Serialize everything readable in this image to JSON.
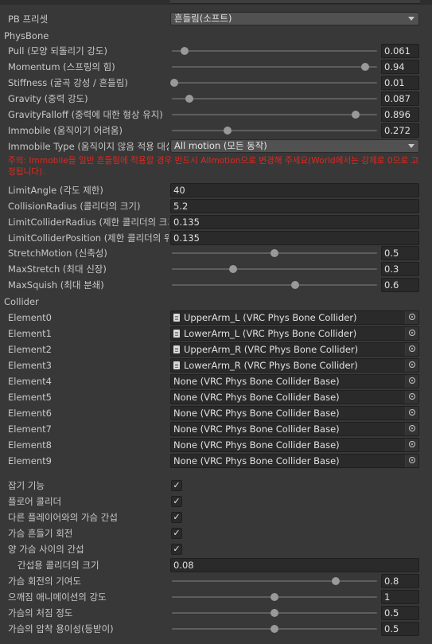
{
  "preset": {
    "label": "PB 프리셋",
    "value": "흔들림(소프트)"
  },
  "physbone_header": "PhysBone",
  "sliders_a": [
    {
      "label": "Pull (모양 되돌리기 강도)",
      "value": "0.061",
      "fraction": 0.061
    },
    {
      "label": "Momentum (스프링의 힘)",
      "value": "0.94",
      "fraction": 0.94
    },
    {
      "label": "Stiffness (굴곡 강성 / 흔들림)",
      "value": "0.01",
      "fraction": 0.01
    },
    {
      "label": "Gravity (중력 강도)",
      "value": "0.087",
      "fraction": 0.087
    },
    {
      "label": "GravityFalloff (중력에 대한 형상 유지)",
      "value": "0.896",
      "fraction": 0.896
    },
    {
      "label": "Immobile (움직이기 어려움)",
      "value": "0.272",
      "fraction": 0.272
    }
  ],
  "immobile_type": {
    "label": "Immobile Type (움직이지 않음 적용 대상)",
    "value": "All motion (모든 동작)"
  },
  "warning": "주의: Immobile을 일반 흔들림에 적용할 경우 반드시 Allmotion으로 변경해 주세요(World에서는 강제로 0으로 고정됩니다).",
  "limits": [
    {
      "label": "LimitAngle (각도 제한)",
      "value": "40"
    },
    {
      "label": "CollisionRadius (콜리더의 크기)",
      "value": "5.2"
    },
    {
      "label": "LimitColliderRadius (제한 콜리더의 크기)",
      "value": "0.135"
    },
    {
      "label": "LimitColliderPosition (제한 콜리더의 위치)",
      "value": "0.135"
    }
  ],
  "sliders_b": [
    {
      "label": "StretchMotion (신축성)",
      "value": "0.5",
      "fraction": 0.5
    },
    {
      "label": "MaxStretch (최대 신장)",
      "value": "0.3",
      "fraction": 0.3
    },
    {
      "label": "MaxSquish (최대 분쇄)",
      "value": "0.6",
      "fraction": 0.6
    }
  ],
  "collider_header": "Collider",
  "colliders": [
    {
      "label": "Element0",
      "value": "UpperArm_L (VRC Phys Bone Collider)",
      "has_file_icon": true
    },
    {
      "label": "Element1",
      "value": "LowerArm_L (VRC Phys Bone Collider)",
      "has_file_icon": true
    },
    {
      "label": "Element2",
      "value": "UpperArm_R (VRC Phys Bone Collider)",
      "has_file_icon": true
    },
    {
      "label": "Element3",
      "value": "LowerArm_R (VRC Phys Bone Collider)",
      "has_file_icon": true
    },
    {
      "label": "Element4",
      "value": "None (VRC Phys Bone Collider Base)",
      "has_file_icon": false
    },
    {
      "label": "Element5",
      "value": "None (VRC Phys Bone Collider Base)",
      "has_file_icon": false
    },
    {
      "label": "Element6",
      "value": "None (VRC Phys Bone Collider Base)",
      "has_file_icon": false
    },
    {
      "label": "Element7",
      "value": "None (VRC Phys Bone Collider Base)",
      "has_file_icon": false
    },
    {
      "label": "Element8",
      "value": "None (VRC Phys Bone Collider Base)",
      "has_file_icon": false
    },
    {
      "label": "Element9",
      "value": "None (VRC Phys Bone Collider Base)",
      "has_file_icon": false
    }
  ],
  "toggles": [
    {
      "label": "잡기 기능",
      "checked": true
    },
    {
      "label": "플로어 콜리더",
      "checked": true
    },
    {
      "label": "다른 플레이어와의 가슴 간섭",
      "checked": true
    },
    {
      "label": "가슴 흔들기 회전",
      "checked": true
    },
    {
      "label": "양 가슴 사이의 간섭",
      "checked": true
    }
  ],
  "check_glyph": "✓",
  "interference_size": {
    "label": "간섭용 콜리더의 크기",
    "value": "0.08"
  },
  "sliders_c": [
    {
      "label": "가슴 회전의 기여도",
      "value": "0.8",
      "fraction": 0.8
    },
    {
      "label": "으깨짐 애니메이션의 강도",
      "value": "1",
      "fraction": 0.5
    },
    {
      "label": "가슴의 처짐 정도",
      "value": "0.5",
      "fraction": 0.5
    },
    {
      "label": "가슴의 압착 용이성(등받이)",
      "value": "0.5",
      "fraction": 0.5
    }
  ]
}
